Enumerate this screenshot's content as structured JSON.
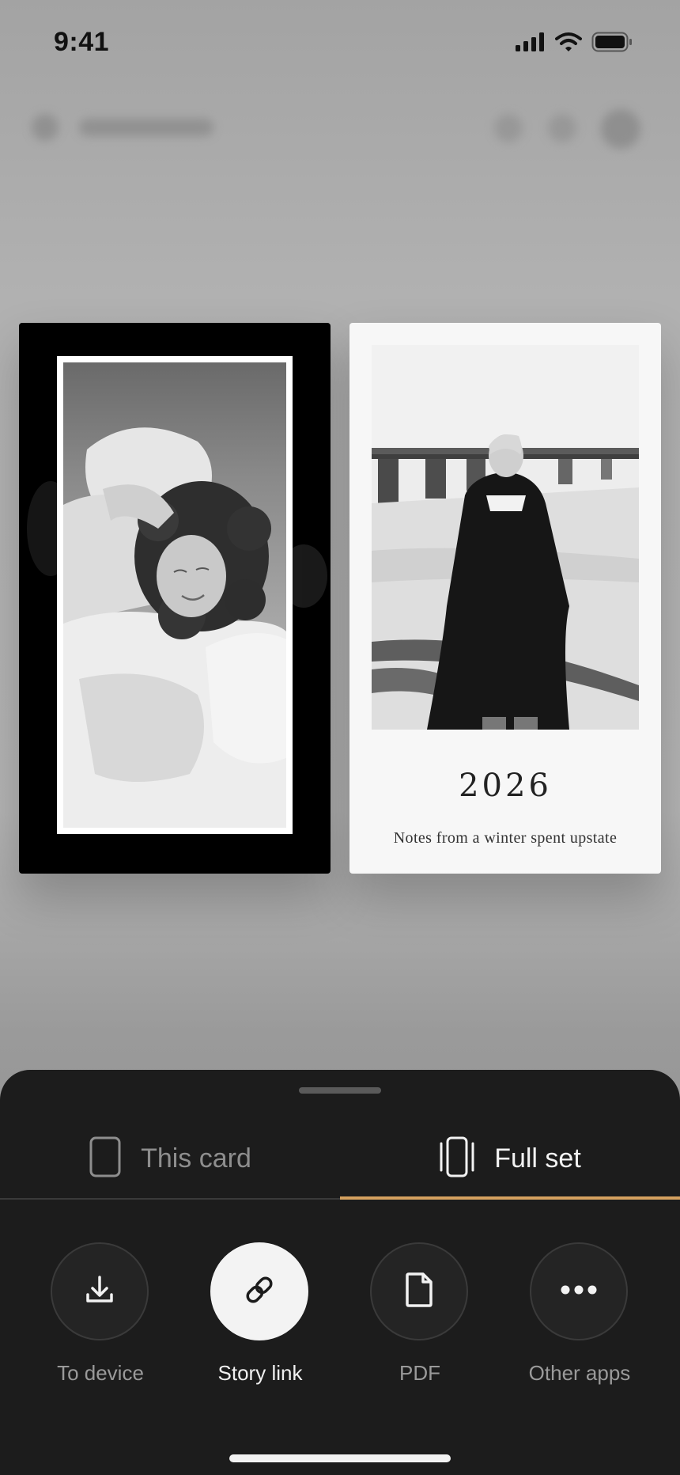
{
  "status_bar": {
    "time": "9:41"
  },
  "cards": {
    "right": {
      "year": "2026",
      "caption": "Notes from a winter spent upstate"
    }
  },
  "sheet": {
    "tabs": [
      {
        "label": "This card",
        "icon": "single-card-icon",
        "selected": false
      },
      {
        "label": "Full set",
        "icon": "card-stack-icon",
        "selected": true
      }
    ],
    "actions": [
      {
        "label": "To device",
        "icon": "download-icon",
        "active": false
      },
      {
        "label": "Story link",
        "icon": "link-icon",
        "active": true
      },
      {
        "label": "PDF",
        "icon": "document-icon",
        "active": false
      },
      {
        "label": "Other apps",
        "icon": "more-icon",
        "active": false
      }
    ]
  },
  "colors": {
    "sheet_bg": "#1c1c1c",
    "accent": "#d4a15f",
    "active_button": "#f3f3f3"
  }
}
